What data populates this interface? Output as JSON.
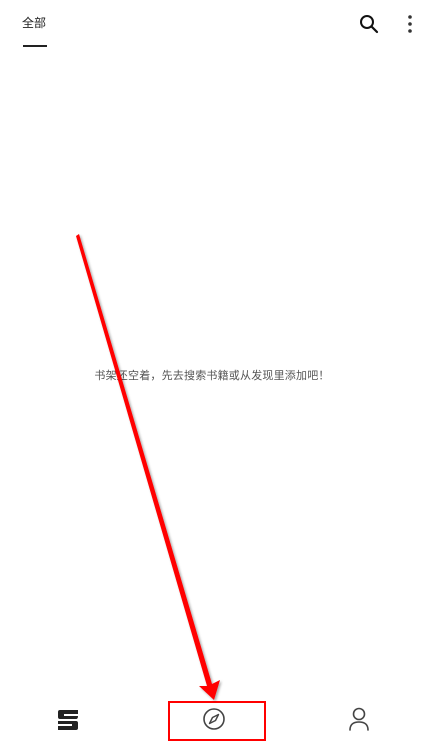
{
  "header": {
    "tab_all": "全部",
    "search_icon": "search-icon",
    "more_icon": "more-vertical-icon"
  },
  "main": {
    "empty_message": "书架还空着，先去搜索书籍或从发现里添加吧！"
  },
  "bottom_nav": {
    "items": [
      {
        "icon": "bookshelf-icon"
      },
      {
        "icon": "compass-icon"
      },
      {
        "icon": "profile-icon"
      }
    ]
  },
  "annotation": {
    "arrow_color": "#ff0000",
    "highlight_color": "#ff0000"
  }
}
